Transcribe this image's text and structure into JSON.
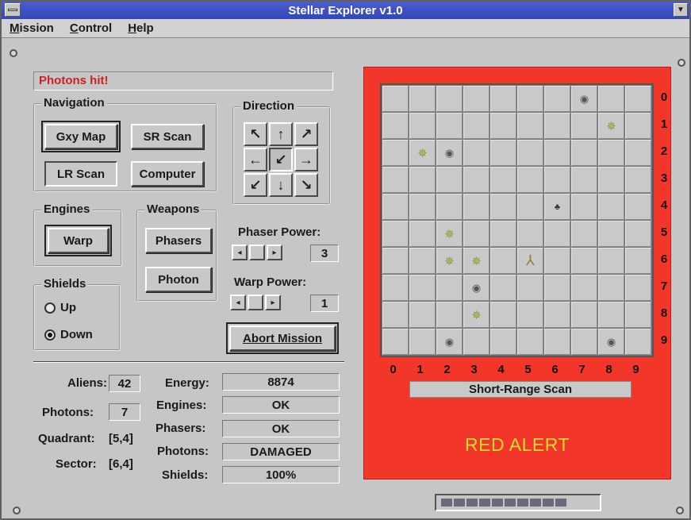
{
  "window": {
    "title": "Stellar Explorer v1.0",
    "minimize_glyph": "▼"
  },
  "menu": [
    "Mission",
    "Control",
    "Help"
  ],
  "message": "Photons hit!",
  "navigation": {
    "title": "Navigation",
    "buttons": [
      "Gxy Map",
      "SR Scan",
      "LR Scan",
      "Computer"
    ]
  },
  "direction": {
    "title": "Direction",
    "arrows": [
      "↖",
      "↑",
      "↗",
      "←",
      "↙",
      "→",
      "↙",
      "↓",
      "↘"
    ],
    "selected_index": 4
  },
  "engines": {
    "title": "Engines",
    "warp_label": "Warp"
  },
  "weapons": {
    "title": "Weapons",
    "phasers_label": "Phasers",
    "photon_label": "Photon"
  },
  "phaser_power": {
    "label": "Phaser Power:",
    "value": "3"
  },
  "warp_power": {
    "label": "Warp Power:",
    "value": "1"
  },
  "shields": {
    "title": "Shields",
    "options": [
      "Up",
      "Down"
    ],
    "selected": "Down"
  },
  "abort_label": "Abort Mission",
  "status_left": {
    "aliens_label": "Aliens:",
    "aliens_value": "42",
    "photons_label": "Photons:",
    "photons_value": "7",
    "quadrant_label": "Quadrant:",
    "quadrant_value": "[5,4]",
    "sector_label": "Sector:",
    "sector_value": "[6,4]"
  },
  "status_right": {
    "energy_label": "Energy:",
    "energy_value": "8874",
    "engines_label": "Engines:",
    "engines_value": "OK",
    "phasers_label": "Phasers:",
    "phasers_value": "OK",
    "photons_label": "Photons:",
    "photons_value": "DAMAGED",
    "shields_label": "Shields:",
    "shields_value": "100%"
  },
  "scan": {
    "label": "Short-Range Scan",
    "col_labels": [
      "0",
      "1",
      "2",
      "3",
      "4",
      "5",
      "6",
      "7",
      "8",
      "9"
    ],
    "row_labels": [
      "0",
      "1",
      "2",
      "3",
      "4",
      "5",
      "6",
      "7",
      "8",
      "9"
    ],
    "objects": [
      {
        "row": 0,
        "col": 7,
        "kind": "base"
      },
      {
        "row": 1,
        "col": 8,
        "kind": "star"
      },
      {
        "row": 2,
        "col": 1,
        "kind": "star"
      },
      {
        "row": 2,
        "col": 2,
        "kind": "base"
      },
      {
        "row": 4,
        "col": 6,
        "kind": "alien"
      },
      {
        "row": 5,
        "col": 2,
        "kind": "star"
      },
      {
        "row": 6,
        "col": 2,
        "kind": "star"
      },
      {
        "row": 6,
        "col": 3,
        "kind": "star"
      },
      {
        "row": 6,
        "col": 5,
        "kind": "ship"
      },
      {
        "row": 7,
        "col": 3,
        "kind": "base"
      },
      {
        "row": 8,
        "col": 3,
        "kind": "star"
      },
      {
        "row": 9,
        "col": 2,
        "kind": "base"
      },
      {
        "row": 9,
        "col": 8,
        "kind": "base"
      }
    ]
  },
  "alert_text": "RED ALERT",
  "colors": {
    "panel": "#f2372a",
    "alert": "#e8dc30",
    "message": "#cc2222"
  }
}
